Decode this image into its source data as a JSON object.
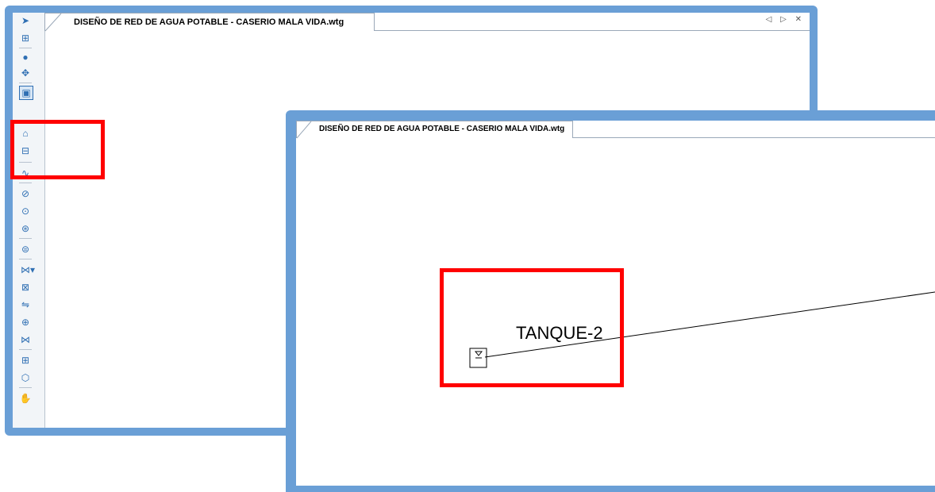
{
  "back_window": {
    "tab_title": "DISEÑO DE RED DE AGUA POTABLE - CASERIO MALA VIDA.wtg",
    "tab_nav": "◁ ▷ ✕",
    "toolbar_icons": [
      "select-arrow-icon",
      "layout-icon",
      "junction-icon",
      "hydrant-icon",
      "tank-icon",
      "reservoir-icon",
      "pressure-pipe-icon",
      "pipe-icon",
      "pump-icon",
      "pump-station-icon",
      "variable-speed-pump-icon",
      "turbine-icon",
      "valve-icon",
      "prv-icon",
      "check-valve-icon",
      "flow-control-valve-icon",
      "isolation-valve-icon",
      "spot-elevation-icon",
      "customer-meter-icon",
      "hand-pan-icon"
    ]
  },
  "front_window": {
    "tab_title": "DISEÑO DE RED DE AGUA POTABLE - CASERIO MALA VIDA.wtg",
    "tank_label": "TANQUE-2"
  },
  "colors": {
    "frame": "#6a9fd6",
    "highlight": "#ff0000",
    "icon": "#2f6fb3"
  }
}
